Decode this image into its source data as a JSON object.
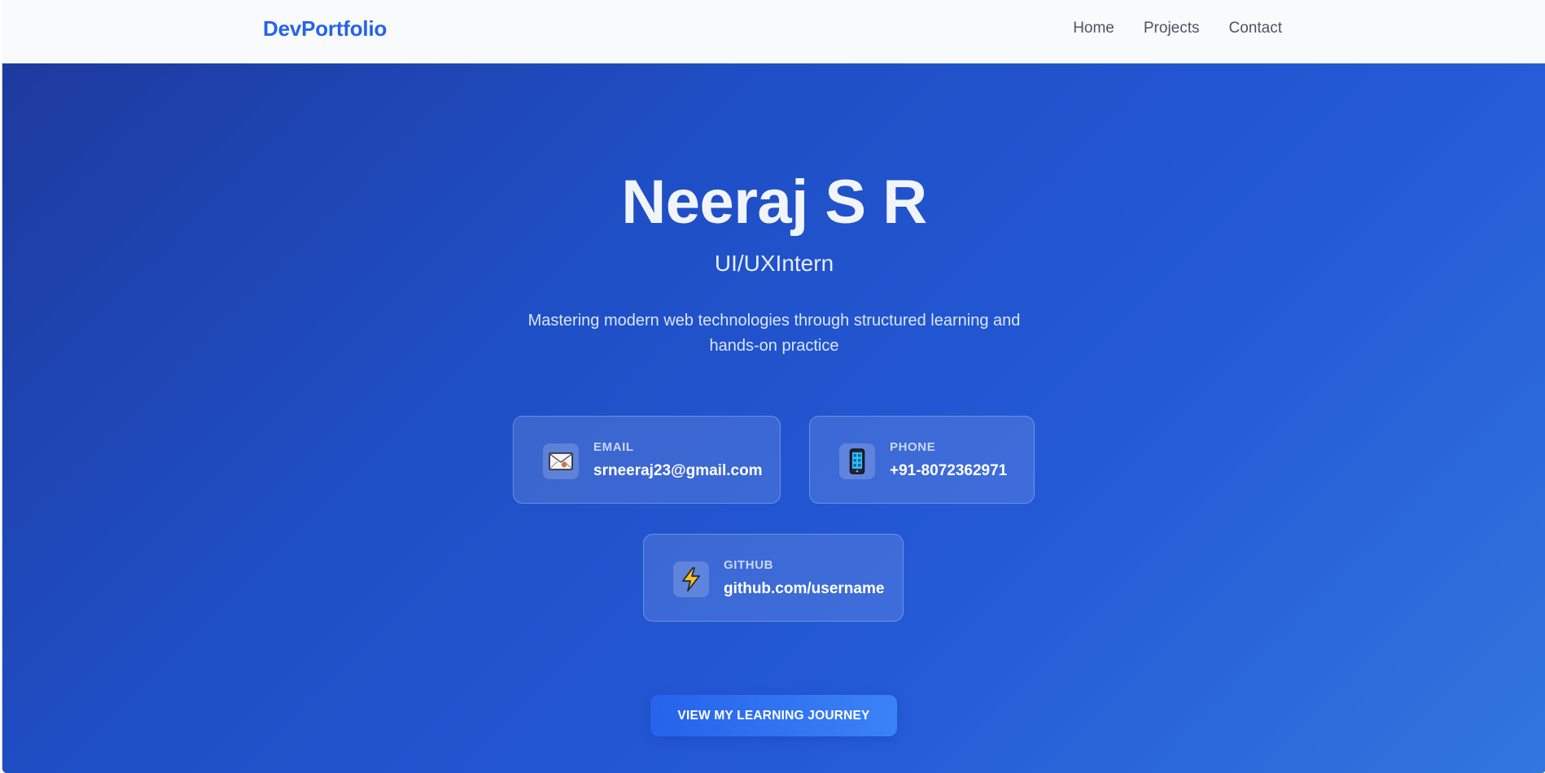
{
  "navbar": {
    "brand": "DevPortfolio",
    "links": [
      {
        "label": "Home"
      },
      {
        "label": "Projects"
      },
      {
        "label": "Contact"
      }
    ]
  },
  "hero": {
    "name": "Neeraj S R",
    "role": "UI/UXIntern",
    "description": "Mastering modern web technologies through structured learning and hands-on practice",
    "cta_label": "VIEW MY LEARNING JOURNEY"
  },
  "contacts": {
    "email": {
      "label": "EMAIL",
      "value": "srneeraj23@gmail.com",
      "icon": "envelope-icon"
    },
    "phone": {
      "label": "PHONE",
      "value": "+91-8072362971",
      "icon": "mobile-phone-icon"
    },
    "github": {
      "label": "GITHUB",
      "value": "github.com/username",
      "icon": "lightning-icon"
    }
  },
  "colors": {
    "brand": "#2563eb",
    "hero_gradient_start": "#1e3a9e",
    "hero_gradient_end": "#3276de",
    "cta": "#2563eb"
  }
}
